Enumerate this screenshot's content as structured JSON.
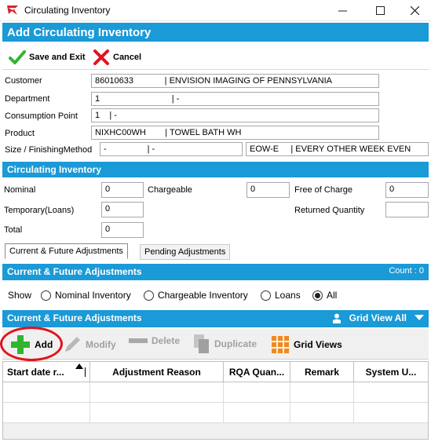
{
  "window": {
    "title": "Circulating Inventory"
  },
  "header": {
    "title": "Add Circulating Inventory"
  },
  "toolbar": {
    "save_label": "Save and Exit",
    "cancel_label": "Cancel"
  },
  "details": {
    "customer_label": "Customer",
    "customer_value": "86010633             | ENVISION IMAGING OF PENNSYLVANIA",
    "department_label": "Department",
    "department_value": "1                              | -",
    "consumption_label": "Consumption Point",
    "consumption_value": "1    | -",
    "product_label": "Product",
    "product_value": "NIXHC00WH        | TOWEL BATH WH",
    "size_label": "Size / FinishingMethod",
    "size_value": "-                 | -",
    "schedule_value": "EOW-E     | EVERY OTHER WEEK EVEN"
  },
  "circulating": {
    "section_title": "Circulating Inventory",
    "nominal_label": "Nominal",
    "nominal_value": "0",
    "chargeable_label": "Chargeable",
    "chargeable_value": "0",
    "free_label": "Free of Charge",
    "free_value": "0",
    "temporary_label": "Temporary(Loans)",
    "temporary_value": "0",
    "returned_label": "Returned Quantity",
    "returned_value": "",
    "total_label": "Total",
    "total_value": "0"
  },
  "tabs": [
    {
      "label": "Current & Future Adjustments",
      "active": true
    },
    {
      "label": "Pending Adjustments",
      "active": false
    }
  ],
  "adjustments": {
    "section_title": "Current & Future Adjustments",
    "count_text": "Count : 0",
    "show_label": "Show",
    "options": [
      {
        "label": "Nominal Inventory",
        "checked": false
      },
      {
        "label": "Chargeable Inventory",
        "checked": false
      },
      {
        "label": "Loans",
        "checked": false
      },
      {
        "label": "All",
        "checked": true
      }
    ]
  },
  "grid_section": {
    "title": "Current & Future Adjustments",
    "grid_view_label": "Grid View All",
    "toolbar": {
      "add": "Add",
      "modify": "Modify",
      "delete": "Delete",
      "duplicate": "Duplicate",
      "grid_views": "Grid Views"
    },
    "columns": [
      "Start date r...",
      "Adjustment Reason",
      "RQA Quan...",
      "Remark",
      "System U..."
    ]
  },
  "colors": {
    "accent": "#1a9ad7",
    "highlight": "#e0141e",
    "add_green": "#2fb52f"
  },
  "icons": {
    "save": "checkmark-icon",
    "cancel": "x-icon",
    "add": "plus-icon",
    "modify": "pencil-icon",
    "delete": "minus-icon",
    "duplicate": "copy-icon",
    "grid_views": "grid-icon",
    "user": "user-icon",
    "dropdown": "triangle-down-icon"
  }
}
